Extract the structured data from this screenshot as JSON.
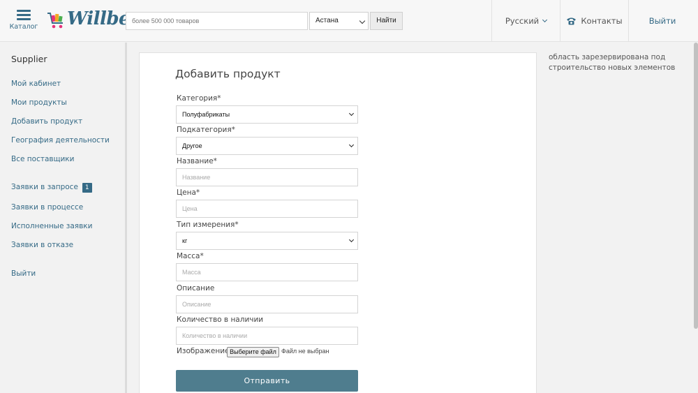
{
  "header": {
    "catalog_label": "Каталог",
    "logo_text": "Willbe",
    "search_placeholder": "более 500 000 товаров",
    "city": "Астана",
    "find_label": "Найти",
    "language": "Русский",
    "contacts": "Контакты",
    "logout": "Выйти"
  },
  "sidebar": {
    "title": "Supplier",
    "items": [
      {
        "label": "Мой кабинет"
      },
      {
        "label": "Мои продукты"
      },
      {
        "label": "Добавить продукт"
      },
      {
        "label": "География деятельности"
      },
      {
        "label": "Все поставщики"
      },
      {
        "label": "Заявки в запросе",
        "badge": "1"
      },
      {
        "label": "Заявки в процессе"
      },
      {
        "label": "Исполненные заявки"
      },
      {
        "label": "Заявки в отказе"
      },
      {
        "label": "Выйти"
      }
    ]
  },
  "form": {
    "title": "Добавить продукт",
    "category": {
      "label": "Категория*",
      "value": "Полуфабрикаты"
    },
    "subcategory": {
      "label": "Подкатегория*",
      "value": "Другое"
    },
    "name": {
      "label": "Название*",
      "placeholder": "Название"
    },
    "price": {
      "label": "Цена*",
      "placeholder": "Цена"
    },
    "unit": {
      "label": "Тип измерения*",
      "value": "кг"
    },
    "mass": {
      "label": "Масса*",
      "placeholder": "Масса"
    },
    "description": {
      "label": "Описание",
      "placeholder": "Описание"
    },
    "quantity": {
      "label": "Количество в наличии",
      "placeholder": "Количество в наличии"
    },
    "image": {
      "label": "Изображение",
      "button": "Выберите файл",
      "status": "Файл не выбран"
    },
    "submit": "Отправить"
  },
  "note": "область зарезервирована под строительство новых элементов",
  "colors": {
    "accent": "#356a86",
    "submit": "#4f7d8e"
  }
}
